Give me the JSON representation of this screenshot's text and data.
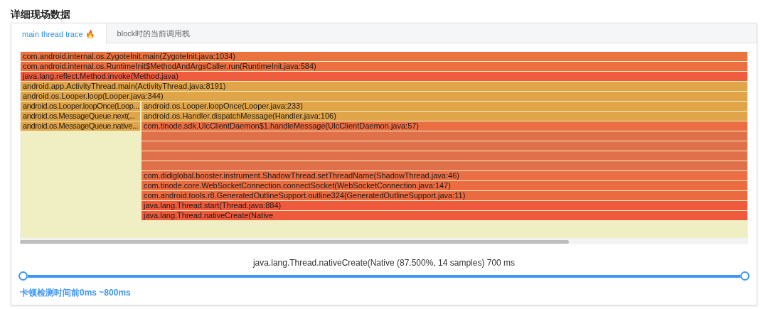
{
  "title": "详细现场数据",
  "tabs": [
    {
      "label": "main thread trace",
      "selected": true,
      "emoji": "🔥"
    },
    {
      "label": "block时的当前调用栈",
      "selected": false
    }
  ],
  "flame_rows": [
    {
      "frames": [
        {
          "kind": "full",
          "text": "com.android.internal.os.ZygoteInit.main(ZygoteInit.java:1034)",
          "color": "#ea7340"
        }
      ]
    },
    {
      "frames": [
        {
          "kind": "full",
          "text": "com.android.internal.os.RuntimeInit$MethodAndArgsCaller.run(RuntimeInit.java:584)",
          "color": "#eb6f41"
        }
      ]
    },
    {
      "frames": [
        {
          "kind": "full",
          "text": "java.lang.reflect.Method.invoke(Method.java)",
          "color": "#f05c3e"
        }
      ]
    },
    {
      "frames": [
        {
          "kind": "full",
          "text": "android.app.ActivityThread.main(ActivityThread.java:8191)",
          "color": "#e0a548"
        }
      ]
    },
    {
      "frames": [
        {
          "kind": "full",
          "text": "android.os.Looper.loop(Looper.java:344)",
          "color": "#e0a548"
        }
      ]
    },
    {
      "frames": [
        {
          "kind": "left",
          "text": "android.os.Looper.loopOnce(Loop...",
          "color": "#e0a548"
        },
        {
          "kind": "right",
          "text": "android.os.Looper.loopOnce(Looper.java:233)",
          "color": "#e0a548"
        }
      ]
    },
    {
      "frames": [
        {
          "kind": "left",
          "text": "android.os.MessageQueue.next(...",
          "color": "#e0a548"
        },
        {
          "kind": "right",
          "text": "android.os.Handler.dispatchMessage(Handler.java:106)",
          "color": "#e0a548"
        }
      ]
    },
    {
      "frames": [
        {
          "kind": "left",
          "text": "android.os.MessageQueue.native...",
          "color": "#e0a548"
        },
        {
          "kind": "right",
          "text": "com.tinode.sdk.UlcClientDaemon$1.handleMessage(UlcClientDaemon.java:57)",
          "color": "#eb6d42"
        }
      ]
    },
    {
      "frames": [
        {
          "kind": "redacted",
          "color": "#e0704a"
        }
      ]
    },
    {
      "frames": [
        {
          "kind": "redacted",
          "color": "#e0704a"
        }
      ]
    },
    {
      "frames": [
        {
          "kind": "redacted",
          "color": "#e0704a"
        }
      ]
    },
    {
      "frames": [
        {
          "kind": "redacted",
          "color": "#e0704a"
        }
      ]
    },
    {
      "frames": [
        {
          "kind": "right",
          "text": "com.didiglobal.booster.instrument.ShadowThread.setThreadName(ShadowThread.java:46)",
          "color": "#eb6e44"
        }
      ]
    },
    {
      "frames": [
        {
          "kind": "right",
          "text": "com.tinode.core.WebSocketConnection.connectSocket(WebSocketConnection.java:147)",
          "color": "#ec6c42"
        }
      ]
    },
    {
      "frames": [
        {
          "kind": "right",
          "text": "com.android.tools.r8.GeneratedOutlineSupport.outline324(GeneratedOutlineSupport.java:11)",
          "color": "#ec6a40"
        }
      ]
    },
    {
      "frames": [
        {
          "kind": "right",
          "text": "java.lang.Thread.start(Thread.java:884)",
          "color": "#f05a3c"
        }
      ]
    },
    {
      "frames": [
        {
          "kind": "right",
          "text": "java.lang.Thread.nativeCreate(Native",
          "color": "#f05a3c"
        }
      ]
    }
  ],
  "hover_info": "java.lang.Thread.nativeCreate(Native (87.500%, 14 samples) 700 ms",
  "range_slider": {
    "handles": [
      {
        "level": 0
      },
      {
        "level": 1
      }
    ]
  },
  "range_label": "卡顿检测时间前0ms ~800ms"
}
